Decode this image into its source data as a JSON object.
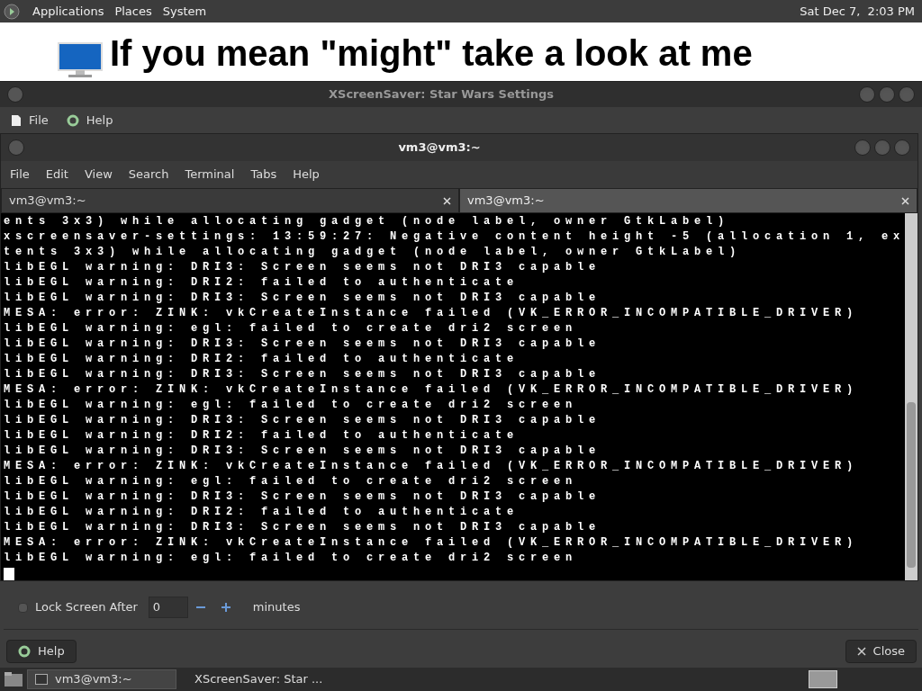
{
  "top_panel": {
    "menus": [
      "Applications",
      "Places",
      "System"
    ],
    "clock": "Sat Dec 7,  2:03 PM"
  },
  "desktop": {
    "banner": "If you mean \"might\" take a look at me"
  },
  "settings_window": {
    "title": "XScreenSaver: Star Wars Settings",
    "menu": [
      "File",
      "Help"
    ],
    "lock_row": {
      "label": "Lock Screen After",
      "checked": false,
      "value": "0",
      "unit": "minutes"
    },
    "buttons": [
      "Help",
      "Close"
    ]
  },
  "terminal": {
    "title": "vm3@vm3:~",
    "menu": [
      "File",
      "Edit",
      "View",
      "Search",
      "Terminal",
      "Tabs",
      "Help"
    ],
    "tabs": [
      {
        "label": "vm3@vm3:~",
        "selected": true
      },
      {
        "label": "vm3@vm3:~",
        "selected": false
      }
    ],
    "lines": [
      "ents 3x3) while allocating gadget (node label, owner GtkLabel)",
      "xscreensaver-settings: 13:59:27: Negative content height -5 (allocation 1, ex",
      "tents 3x3) while allocating gadget (node label, owner GtkLabel)",
      "libEGL warning: DRI3: Screen seems not DRI3 capable",
      "libEGL warning: DRI2: failed to authenticate",
      "libEGL warning: DRI3: Screen seems not DRI3 capable",
      "MESA: error: ZINK: vkCreateInstance failed (VK_ERROR_INCOMPATIBLE_DRIVER)",
      "libEGL warning: egl: failed to create dri2 screen",
      "libEGL warning: DRI3: Screen seems not DRI3 capable",
      "libEGL warning: DRI2: failed to authenticate",
      "libEGL warning: DRI3: Screen seems not DRI3 capable",
      "MESA: error: ZINK: vkCreateInstance failed (VK_ERROR_INCOMPATIBLE_DRIVER)",
      "libEGL warning: egl: failed to create dri2 screen",
      "libEGL warning: DRI3: Screen seems not DRI3 capable",
      "libEGL warning: DRI2: failed to authenticate",
      "libEGL warning: DRI3: Screen seems not DRI3 capable",
      "MESA: error: ZINK: vkCreateInstance failed (VK_ERROR_INCOMPATIBLE_DRIVER)",
      "libEGL warning: egl: failed to create dri2 screen",
      "libEGL warning: DRI3: Screen seems not DRI3 capable",
      "libEGL warning: DRI2: failed to authenticate",
      "libEGL warning: DRI3: Screen seems not DRI3 capable",
      "MESA: error: ZINK: vkCreateInstance failed (VK_ERROR_INCOMPATIBLE_DRIVER)",
      "libEGL warning: egl: failed to create dri2 screen"
    ]
  },
  "taskbar": {
    "tasks": [
      {
        "label": "vm3@vm3:~",
        "kind": "terminal",
        "selected": true
      },
      {
        "label": "XScreenSaver: Star ...",
        "kind": "window",
        "selected": false
      }
    ]
  }
}
